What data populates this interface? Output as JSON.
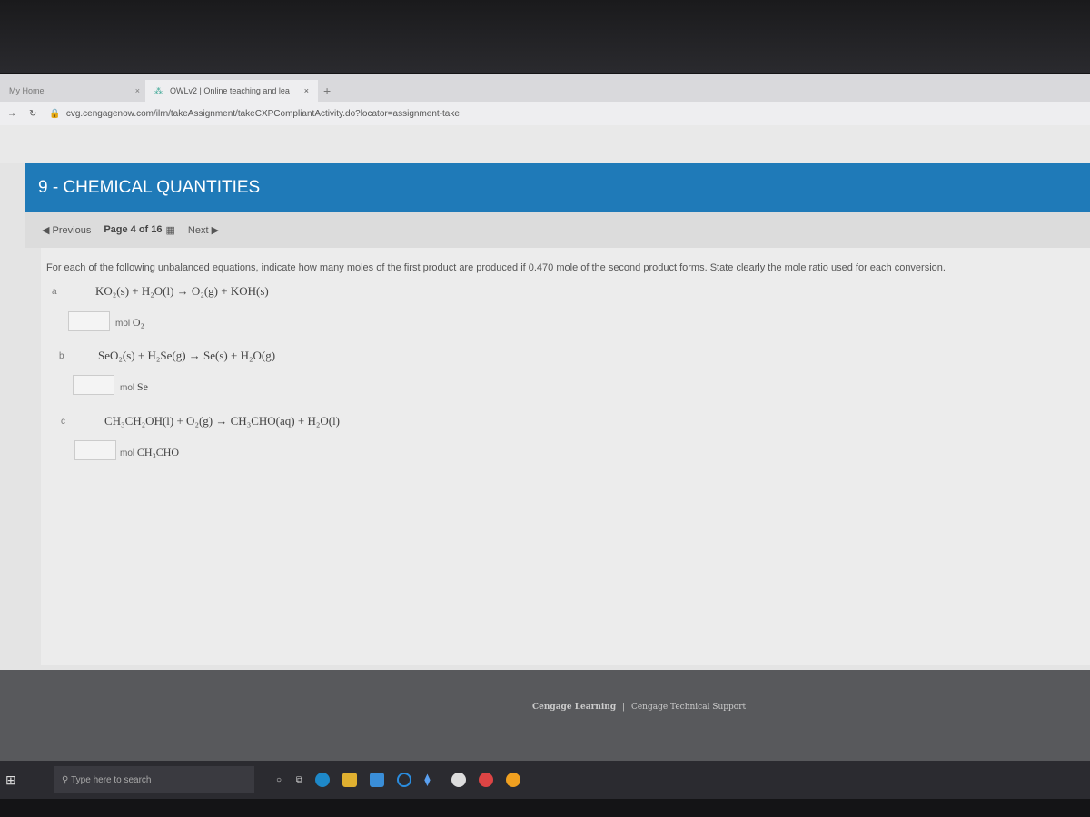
{
  "browser": {
    "tabs": [
      {
        "label": "My Home",
        "active": false
      },
      {
        "label": "OWLv2 | Online teaching and lea",
        "active": true
      }
    ],
    "new_tab": "+",
    "close": "×",
    "url": "cvg.cengagenow.com/ilrn/takeAssignment/takeCXPCompliantActivity.do?locator=assignment-take"
  },
  "header": {
    "title": "9 - CHEMICAL QUANTITIES",
    "color": "#1f7ab8"
  },
  "nav": {
    "previous": "Previous",
    "page": "Page 4 of 16",
    "next": "Next"
  },
  "question": {
    "instructions": "For each of the following unbalanced equations, indicate how many moles of the first product are produced if 0.470 mole of the second product forms. State clearly the mole ratio used for each conversion.",
    "parts": [
      {
        "label": "a",
        "equation": "KO₂(s) + H₂O(l) → O₂(g) + KOH(s)",
        "value": "",
        "unit_prefix": "mol",
        "unit": "O₂"
      },
      {
        "label": "b",
        "equation": "SeO₂(s) + H₂Se(g) → Se(s) + H₂O(g)",
        "value": "",
        "unit_prefix": "mol",
        "unit": "Se"
      },
      {
        "label": "c",
        "equation": "CH₃CH₂OH(l) + O₂(g) → CH₃CHO(aq) + H₂O(l)",
        "value": "",
        "unit_prefix": "mol",
        "unit": "CH₃CHO"
      }
    ]
  },
  "footer": {
    "links": [
      "Cengage Learning",
      "Cengage Technical Support"
    ],
    "sep": "|"
  },
  "taskbar": {
    "search_placeholder": "Type here to search"
  }
}
